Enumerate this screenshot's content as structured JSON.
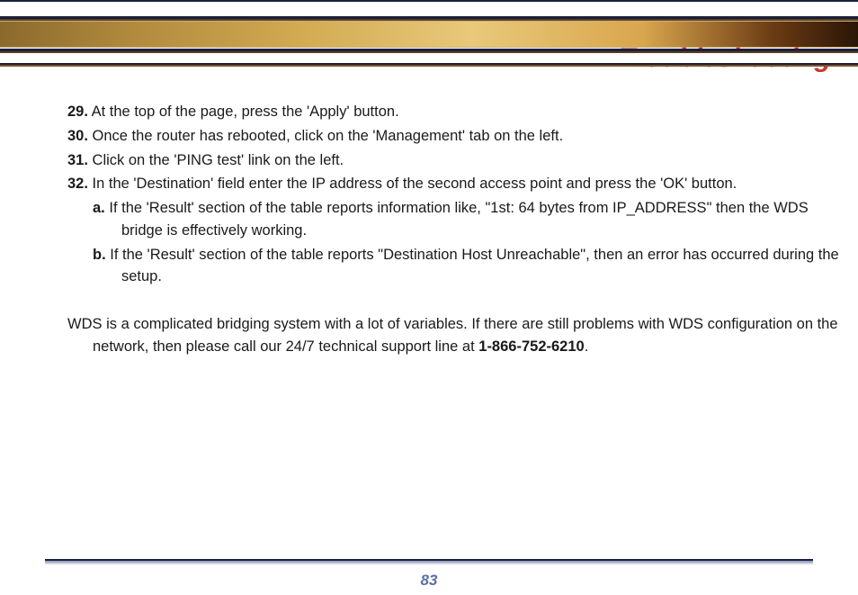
{
  "header": {
    "title": "Troubleshooting"
  },
  "steps": [
    {
      "num": "29.",
      "text": "At the top of the page, press the 'Apply' button."
    },
    {
      "num": "30.",
      "text": "Once the router has rebooted, click on the 'Management' tab on the left."
    },
    {
      "num": "31.",
      "text": "Click on the 'PING test' link on the left."
    },
    {
      "num": "32.",
      "text": "In the 'Destination' field enter the IP address of the second access point and press the 'OK' button."
    }
  ],
  "subs": [
    {
      "lab": "a.",
      "text": "If the 'Result' section of the table reports information like, \"1st: 64 bytes from IP_ADDRESS\" then the WDS bridge is effectively working."
    },
    {
      "lab": "b.",
      "text": "If the 'Result' section of the table reports \"Destination Host Unreachable\", then an error has occurred during the setup."
    }
  ],
  "paragraph": {
    "pre": "WDS is a complicated bridging system with a lot of variables. If there are still problems with WDS configuration on the network, then please call our 24/7 technical support line at ",
    "phone": "1-866-752-6210",
    "post": "."
  },
  "page": "83"
}
